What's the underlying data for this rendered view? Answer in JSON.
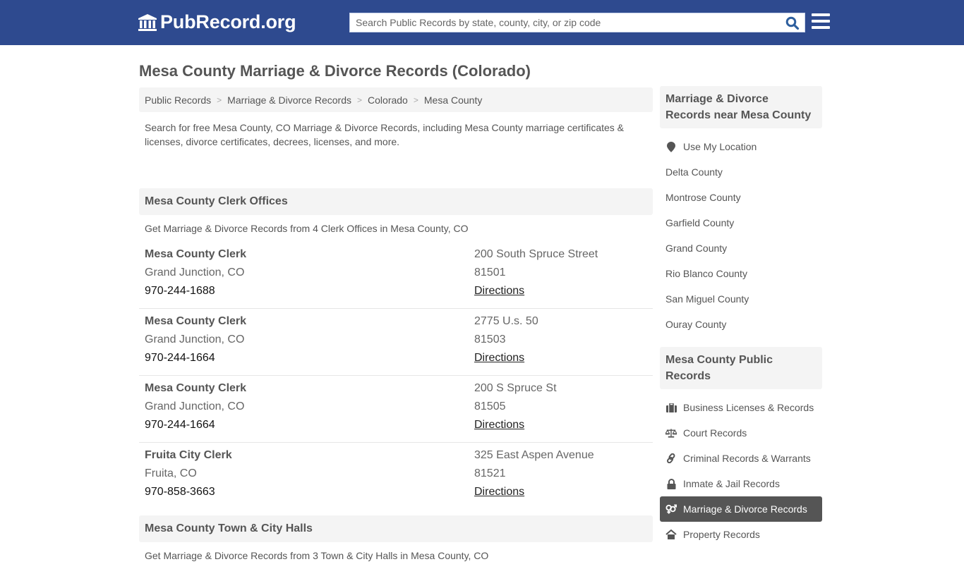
{
  "header": {
    "logo_text": "PubRecord.org",
    "logo_icon": "bank-building-icon",
    "search_placeholder": "Search Public Records by state, county, city, or zip code",
    "search_value": "",
    "search_icon": "search-icon",
    "menu_icon": "hamburger-menu-icon"
  },
  "page": {
    "title": "Mesa County Marriage & Divorce Records (Colorado)",
    "breadcrumb": [
      {
        "label": "Public Records"
      },
      {
        "label": "Marriage & Divorce Records"
      },
      {
        "label": "Colorado"
      },
      {
        "label": "Mesa County"
      }
    ],
    "breadcrumb_separator": ">",
    "intro": "Search for free Mesa County, CO Marriage & Divorce Records, including Mesa County marriage certificates & licenses, divorce certificates, decrees, licenses, and more."
  },
  "sections": [
    {
      "title": "Mesa County Clerk Offices",
      "subtitle": "Get Marriage & Divorce Records from 4 Clerk Offices in Mesa County, CO",
      "offices": [
        {
          "name": "Mesa County Clerk",
          "city": "Grand Junction, CO",
          "phone": "970-244-1688",
          "address": "200 South Spruce Street",
          "zip": "81501",
          "directions": "Directions"
        },
        {
          "name": "Mesa County Clerk",
          "city": "Grand Junction, CO",
          "phone": "970-244-1664",
          "address": "2775 U.s. 50",
          "zip": "81503",
          "directions": "Directions"
        },
        {
          "name": "Mesa County Clerk",
          "city": "Grand Junction, CO",
          "phone": "970-244-1664",
          "address": "200 S Spruce St",
          "zip": "81505",
          "directions": "Directions"
        },
        {
          "name": "Fruita City Clerk",
          "city": "Fruita, CO",
          "phone": "970-858-3663",
          "address": "325 East Aspen Avenue",
          "zip": "81521",
          "directions": "Directions"
        }
      ]
    },
    {
      "title": "Mesa County Town & City Halls",
      "subtitle": "Get Marriage & Divorce Records from 3 Town & City Halls in Mesa County, CO"
    }
  ],
  "sidebar": {
    "nearby": {
      "title": "Marriage & Divorce Records near Mesa County",
      "use_location": {
        "label": "Use My Location",
        "icon": "map-marker-icon"
      },
      "items": [
        {
          "label": "Delta County"
        },
        {
          "label": "Montrose County"
        },
        {
          "label": "Garfield County"
        },
        {
          "label": "Grand County"
        },
        {
          "label": "Rio Blanco County"
        },
        {
          "label": "San Miguel County"
        },
        {
          "label": "Ouray County"
        }
      ]
    },
    "public_records": {
      "title": "Mesa County Public Records",
      "items": [
        {
          "label": "Business Licenses & Records",
          "icon": "briefcase-icon",
          "active": false
        },
        {
          "label": "Court Records",
          "icon": "balance-scale-icon",
          "active": false
        },
        {
          "label": "Criminal Records & Warrants",
          "icon": "chain-link-icon",
          "active": false
        },
        {
          "label": "Inmate & Jail Records",
          "icon": "lock-icon",
          "active": false
        },
        {
          "label": "Marriage & Divorce Records",
          "icon": "venus-mars-icon",
          "active": true
        },
        {
          "label": "Property Records",
          "icon": "house-icon",
          "active": false
        }
      ]
    }
  },
  "colors": {
    "brand": "#2e4a8f",
    "active_item_bg": "#555555",
    "panel_bg": "#f4f4f4",
    "text": "#555555"
  }
}
